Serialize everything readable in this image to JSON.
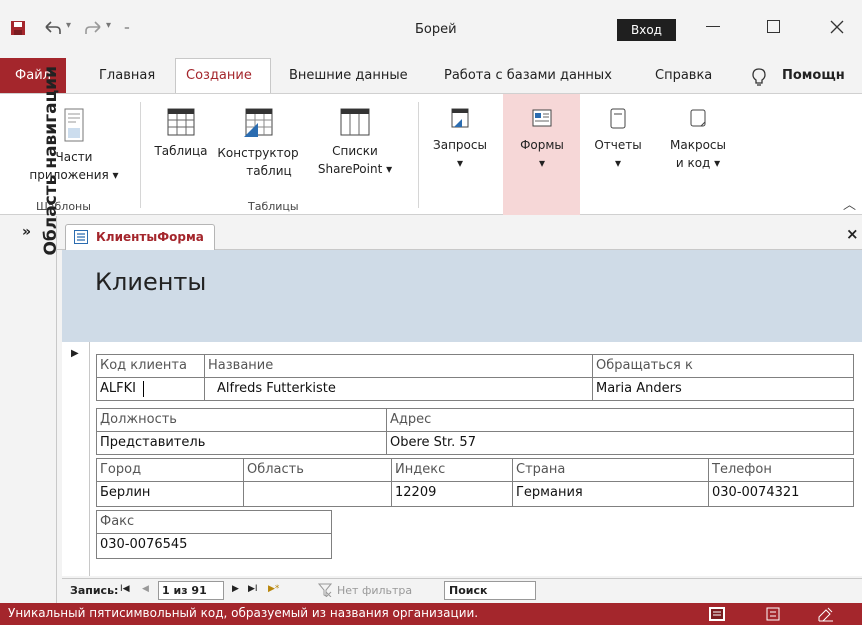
{
  "window": {
    "title": "Борей",
    "login_label": "Вход",
    "icons": [
      "save-icon",
      "undo-icon",
      "redo-icon",
      "customize-icon",
      "minimize-icon",
      "maximize-icon",
      "close-icon"
    ]
  },
  "menu": {
    "tabs": [
      "Файл",
      "Главная",
      "Создание",
      "Внешние данные",
      "Работа с базами данных",
      "Справка",
      "Помощн"
    ],
    "active": "Создание"
  },
  "ribbon": {
    "buttons": [
      {
        "line1": "Части",
        "line2": "приложения ▾",
        "icon": "app-parts-icon"
      },
      {
        "line1": "Таблица",
        "line2": "",
        "icon": "table-icon"
      },
      {
        "line1": "Конструктор",
        "line2": "таблиц",
        "icon": "table-design-icon"
      },
      {
        "line1": "Списки",
        "line2": "SharePoint ▾",
        "icon": "sharepoint-lists-icon"
      },
      {
        "line1": "Запросы",
        "line2": "▾",
        "icon": "queries-icon"
      },
      {
        "line1": "Формы",
        "line2": "▾",
        "icon": "forms-icon"
      },
      {
        "line1": "Отчеты",
        "line2": "▾",
        "icon": "reports-icon"
      },
      {
        "line1": "Макросы",
        "line2": "и код ▾",
        "icon": "macros-icon"
      }
    ],
    "groups": [
      "Шаблоны",
      "Таблицы"
    ],
    "collapse_glyph": "^"
  },
  "nav_pane": {
    "label": "Область навигации",
    "expand_glyph": "»"
  },
  "doc": {
    "tab_label": "КлиентыФорма",
    "close_glyph": "×",
    "form_title": "Клиенты"
  },
  "fields": {
    "customer_id": {
      "label": "Код клиента",
      "value": "ALFKI"
    },
    "name": {
      "label": "Название",
      "value": "Alfreds Futterkiste"
    },
    "contact": {
      "label": "Обращаться к",
      "value": "Maria Anders"
    },
    "position": {
      "label": "Должность",
      "value": "Представитель"
    },
    "address": {
      "label": "Адрес",
      "value": "Obere Str. 57"
    },
    "city": {
      "label": "Город",
      "value": "Берлин"
    },
    "region": {
      "label": "Область",
      "value": ""
    },
    "postal": {
      "label": "Индекс",
      "value": "12209"
    },
    "country": {
      "label": "Страна",
      "value": "Германия"
    },
    "phone": {
      "label": "Телефон",
      "value": "030-0074321"
    },
    "fax": {
      "label": "Факс",
      "value": "030-0076545"
    }
  },
  "record_nav": {
    "label": "Запись:",
    "first": "I◀",
    "prev": "◀",
    "position": "1 из 91",
    "next": "▶",
    "last": "▶I",
    "new": "▶*",
    "filter": "Нет фильтра",
    "search_placeholder": "Поиск"
  },
  "status": {
    "text": "Уникальный пятисимвольный код, образуемый из названия организации."
  }
}
